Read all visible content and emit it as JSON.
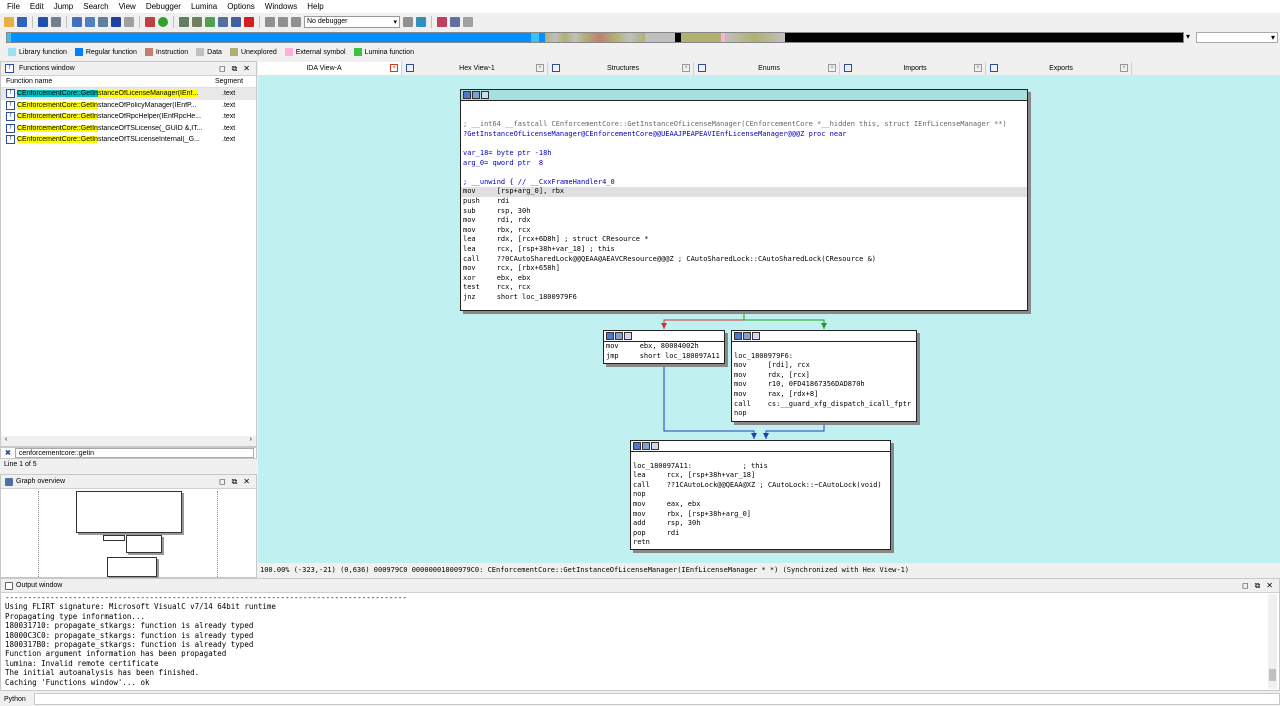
{
  "menu": [
    "File",
    "Edit",
    "Jump",
    "Search",
    "View",
    "Debugger",
    "Lumina",
    "Options",
    "Windows",
    "Help"
  ],
  "toolbar": {
    "debugger_value": "No debugger"
  },
  "legend": [
    {
      "label": "Library function",
      "color": "#a0e0f0"
    },
    {
      "label": "Regular function",
      "color": "#0080ff"
    },
    {
      "label": "Instruction",
      "color": "#c08070"
    },
    {
      "label": "Data",
      "color": "#c0c0c0"
    },
    {
      "label": "Unexplored",
      "color": "#b0b070"
    },
    {
      "label": "External symbol",
      "color": "#ffb0e0"
    },
    {
      "label": "Lumina function",
      "color": "#40c040"
    }
  ],
  "functions_window": {
    "title": "Functions window",
    "col_name": "Function name",
    "col_segment": "Segment",
    "rows": [
      {
        "prefix": "CEnforcementCore::GetIn",
        "rest": "stanceOfLicenseManager(IEnf...",
        "segment": ".text"
      },
      {
        "prefix": "CEnforcementCore::GetIn",
        "rest": "stanceOfPolicyManager(IEnfP...",
        "segment": ".text"
      },
      {
        "prefix": "CEnforcementCore::GetIn",
        "rest": "stanceOfRpcHelper(IEnfRpcHe...",
        "segment": ".text"
      },
      {
        "prefix": "CEnforcementCore::GetIn",
        "rest": "stanceOfTSLicense(_GUID &,IT...",
        "segment": ".text"
      },
      {
        "prefix": "CEnforcementCore::GetIn",
        "rest": "stanceOfTSLicenseInternal(_G...",
        "segment": ".text"
      }
    ],
    "filter": "cenforcementcore::getin",
    "line_count": "Line 1 of 5"
  },
  "graph_overview": {
    "title": "Graph overview"
  },
  "tabs": [
    {
      "label": "IDA View-A",
      "active": true
    },
    {
      "label": "Hex View-1"
    },
    {
      "label": "Structures"
    },
    {
      "label": "Enums"
    },
    {
      "label": "Imports"
    },
    {
      "label": "Exports"
    }
  ],
  "graph": {
    "block1": [
      {
        "t": ""
      },
      {
        "t": ""
      },
      {
        "t": "; __int64 __fastcall CEnforcementCore::GetInstanceOfLicenseManager(CEnforcementCore *__hidden this, struct IEnfLicenseManager **)",
        "c": "cmt"
      },
      {
        "t": "?GetInstanceOfLicenseManager@CEnforcementCore@@UEAAJPEAPEAVIEnfLicenseManager@@@Z proc near",
        "c": "blue"
      },
      {
        "t": ""
      },
      {
        "t": "var_18= byte ptr -18h",
        "c": "blue"
      },
      {
        "t": "arg_0= qword ptr  8",
        "c": "blue"
      },
      {
        "t": ""
      },
      {
        "t": "; __unwind { // __CxxFrameHandler4_0",
        "c": "blue"
      },
      {
        "t": "mov     [rsp+arg_0], rbx",
        "sel": true
      },
      {
        "t": "push    rdi"
      },
      {
        "t": "sub     rsp, 30h"
      },
      {
        "t": "mov     rdi, rdx"
      },
      {
        "t": "mov     rbx, rcx"
      },
      {
        "t": "lea     rdx, [rcx+6D8h] ; struct CResource *"
      },
      {
        "t": "lea     rcx, [rsp+38h+var_18] ; this"
      },
      {
        "t": "call    ??0CAutoSharedLock@@QEAA@AEAVCResource@@@Z ; CAutoSharedLock::CAutoSharedLock(CResource &)"
      },
      {
        "t": "mov     rcx, [rbx+658h]"
      },
      {
        "t": "xor     ebx, ebx"
      },
      {
        "t": "test    rcx, rcx"
      },
      {
        "t": "jnz     short loc_1800979F6"
      }
    ],
    "block2": [
      {
        "t": "mov     ebx, 80004002h"
      },
      {
        "t": "jmp     short loc_180097A11"
      }
    ],
    "block3": [
      {
        "t": ""
      },
      {
        "t": "loc_1800979F6:"
      },
      {
        "t": "mov     [rdi], rcx"
      },
      {
        "t": "mov     rdx, [rcx]"
      },
      {
        "t": "mov     r10, 0FD41867356DAD870h"
      },
      {
        "t": "mov     rax, [rdx+8]"
      },
      {
        "t": "call    cs:__guard_xfg_dispatch_icall_fptr"
      },
      {
        "t": "nop"
      }
    ],
    "block4": [
      {
        "t": ""
      },
      {
        "t": "loc_180097A11:            ; this"
      },
      {
        "t": "lea     rcx, [rsp+38h+var_18]"
      },
      {
        "t": "call    ??1CAutoLock@@QEAA@XZ ; CAutoLock::~CAutoLock(void)"
      },
      {
        "t": "nop"
      },
      {
        "t": "mov     eax, ebx"
      },
      {
        "t": "mov     rbx, [rsp+38h+arg_0]"
      },
      {
        "t": "add     rsp, 30h"
      },
      {
        "t": "pop     rdi"
      },
      {
        "t": "retn"
      }
    ]
  },
  "status_line": "100.00% (-323,-21) (0,636) 000979C0 00000001800979C0: CEnforcementCore::GetInstanceOfLicenseManager(IEnfLicenseManager * *) (Synchronized with Hex View-1)",
  "output": {
    "title": "Output window",
    "lines": [
      "-----------------------------------------------------------------------------------------",
      "Using FLIRT signature: Microsoft VisualC v7/14 64bit runtime",
      "Propagating type information...",
      "180031710: propagate_stkargs: function is already typed",
      "18000C3C0: propagate_stkargs: function is already typed",
      "1800317B0: propagate_stkargs: function is already typed",
      "Function argument information has been propagated",
      "lumina: Invalid remote certificate",
      "The initial autoanalysis has been finished.",
      "Caching 'Functions window'... ok"
    ]
  },
  "python_label": "Python"
}
